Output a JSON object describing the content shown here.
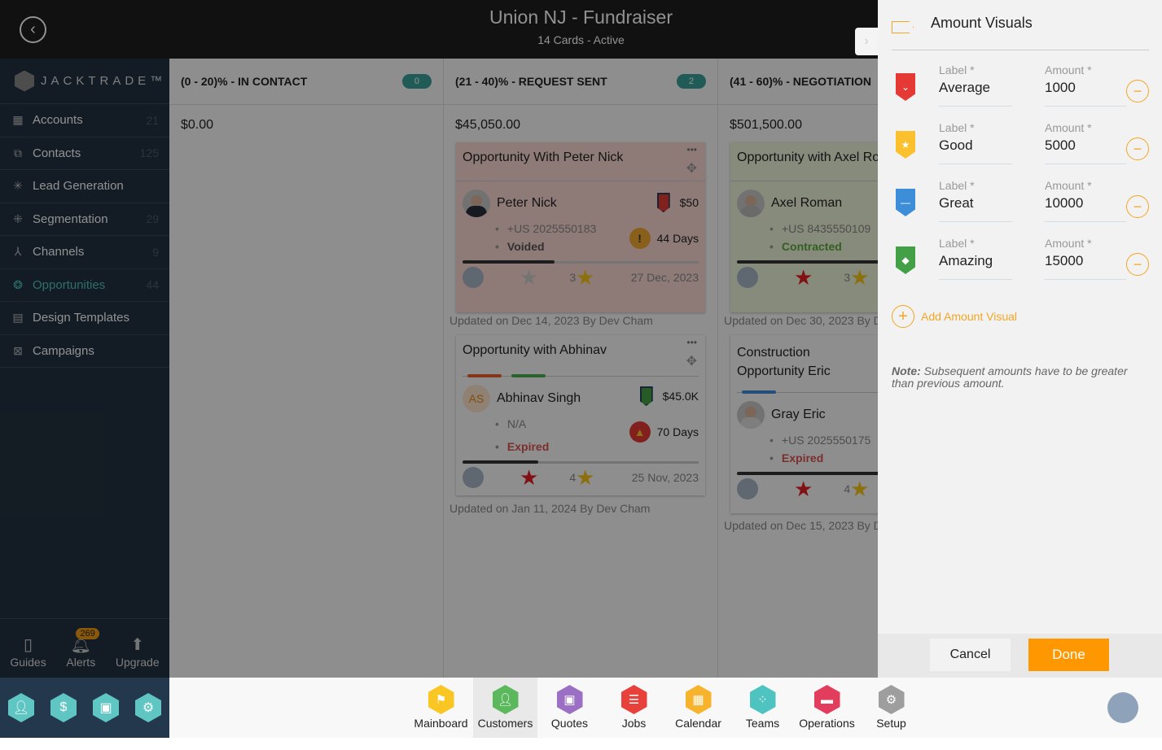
{
  "header": {
    "title": "Union NJ - Fundraiser",
    "subtitle": "14 Cards - Active"
  },
  "sidebar": {
    "brand": "JACKTRADE™",
    "items": [
      {
        "label": "Accounts",
        "count": "21",
        "icon": "building-icon"
      },
      {
        "label": "Contacts",
        "count": "125",
        "icon": "contacts-icon"
      },
      {
        "label": "Lead Generation",
        "count": "",
        "icon": "lead-icon"
      },
      {
        "label": "Segmentation",
        "count": "29",
        "icon": "segmentation-icon"
      },
      {
        "label": "Channels",
        "count": "9",
        "icon": "channels-icon"
      },
      {
        "label": "Opportunities",
        "count": "44",
        "icon": "opportunities-icon",
        "active": true
      },
      {
        "label": "Design Templates",
        "count": "",
        "icon": "templates-icon"
      },
      {
        "label": "Campaigns",
        "count": "",
        "icon": "campaigns-icon"
      }
    ],
    "utilities": [
      {
        "label": "Guides"
      },
      {
        "label": "Alerts",
        "badge": "269"
      },
      {
        "label": "Upgrade"
      }
    ]
  },
  "columns": [
    {
      "title": "(0 - 20)% - IN CONTACT",
      "count": "0",
      "total": "$0.00"
    },
    {
      "title": "(21 - 40)% - REQUEST SENT",
      "count": "2",
      "total": "$45,050.00"
    },
    {
      "title": "(41 - 60)% - NEGOTIATION",
      "total": "$501,500.00"
    }
  ],
  "cards": [
    {
      "title": "Opportunity With Peter Nick",
      "name": "Peter Nick",
      "phone": "+US 2025550183",
      "status": "Voided",
      "amount": "$50",
      "days": "44 Days",
      "rating": "3",
      "date": "27 Dec, 2023",
      "updated": "Updated on Dec 14, 2023 By Dev Cham",
      "progress": 0.39,
      "bg": "#f9d9d3"
    },
    {
      "title": "Opportunity with Abhinav",
      "initials": "AS",
      "name": "Abhinav Singh",
      "phone": "N/A",
      "status": "Expired",
      "amount": "$45.0K",
      "days": "70 Days",
      "rating": "4",
      "date": "25 Nov, 2023",
      "updated": "Updated on Jan 11, 2024 By Dev Cham",
      "progress": 0.32,
      "bg": "#fafafa"
    },
    {
      "title": "Opportunity with Axel Ro",
      "name": "Axel Roman",
      "phone": "+US 8435550109",
      "status": "Contracted",
      "rating": "3",
      "updated": "Updated on Dec 30, 2023 By D",
      "progress": 0.98,
      "bg": "#eef5d9"
    },
    {
      "title": "Construction Opportunity Eric",
      "name": "Gray Eric",
      "phone": "+US 2025550175",
      "status": "Expired",
      "rating": "4",
      "updated": "Updated on Dec 15, 2023 By D",
      "progress": 0.8,
      "bg": "#fafafa"
    }
  ],
  "panel": {
    "title": "Amount Visuals",
    "label_caption": "Label *",
    "amount_caption": "Amount *",
    "rows": [
      {
        "label": "Average",
        "amount": "1000",
        "color": "#e53935"
      },
      {
        "label": "Good",
        "amount": "5000",
        "color": "#fbc02d"
      },
      {
        "label": "Great",
        "amount": "10000",
        "color": "#3d8ed8"
      },
      {
        "label": "Amazing",
        "amount": "15000",
        "color": "#43a047"
      }
    ],
    "add_label": "Add Amount Visual",
    "note_bold": "Note:",
    "note": " Subsequent amounts have to be greater than previous amount.",
    "cancel": "Cancel",
    "done": "Done"
  },
  "apps": [
    {
      "label": "Mainboard",
      "color": "#f9c623"
    },
    {
      "label": "Customers",
      "color": "#5cb85c",
      "selected": true
    },
    {
      "label": "Quotes",
      "color": "#9b6fc3"
    },
    {
      "label": "Jobs",
      "color": "#e8413c"
    },
    {
      "label": "Calendar",
      "color": "#f7b32b"
    },
    {
      "label": "Teams",
      "color": "#4fc3c0"
    },
    {
      "label": "Operations",
      "color": "#e23d5c"
    },
    {
      "label": "Setup",
      "color": "#9e9e9e"
    }
  ]
}
